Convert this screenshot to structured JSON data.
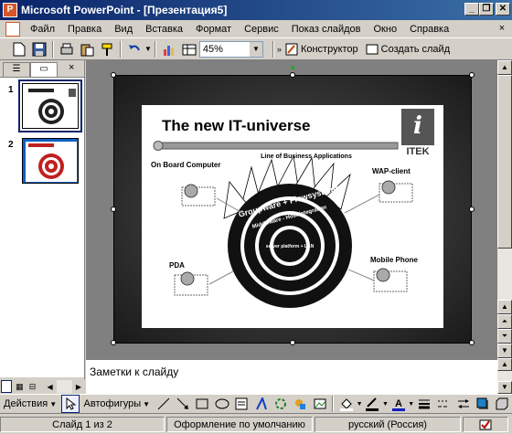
{
  "window": {
    "title": "Microsoft PowerPoint - [Презентация5]",
    "minimize": "_",
    "restore": "❐",
    "close": "✕"
  },
  "menu": {
    "items": [
      "Файл",
      "Правка",
      "Вид",
      "Вставка",
      "Формат",
      "Сервис",
      "Показ слайдов",
      "Окно",
      "Справка"
    ],
    "close": "×"
  },
  "toolbar": {
    "zoom": "45%",
    "designer_label": "Конструктор",
    "new_slide_label": "Создать слайд"
  },
  "left_pane": {
    "close": "×",
    "slides": [
      {
        "number": "1",
        "selected": true
      },
      {
        "number": "2",
        "selected": false
      }
    ]
  },
  "slide": {
    "title": "The new IT-universe",
    "logo_text": "ITEK",
    "top_label": "Line of Business Applications",
    "labels": {
      "onboard": "On Board Computer",
      "wap": "WAP-client",
      "pda": "PDA",
      "mobile": "Mobile Phone"
    },
    "ring_text": "Groupware + Flowsystems",
    "ring_text2": "Middleware - Host integration",
    "center_text": "server platform + LAN"
  },
  "notes": {
    "placeholder": "Заметки к слайду"
  },
  "drawing_toolbar": {
    "actions_label": "Действия",
    "autoshapes_label": "Автофигуры"
  },
  "status": {
    "slide_count": "Слайд 1 из 2",
    "design": "Оформление по умолчанию",
    "language": "русский (Россия)"
  }
}
